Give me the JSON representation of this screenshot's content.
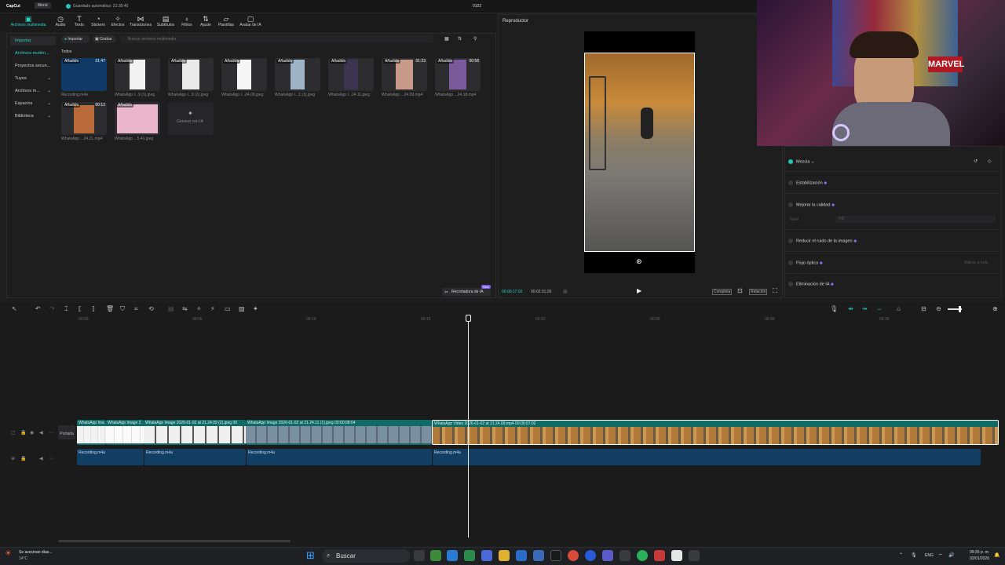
{
  "titlebar": {
    "app": "CapCut",
    "menu": "Menú",
    "autosave": "Guardado automático: 21:35:40",
    "project": "0102"
  },
  "tabs": [
    {
      "label": "Archivos multimedia",
      "icon": "media-icon"
    },
    {
      "label": "Audio",
      "icon": "audio-icon"
    },
    {
      "label": "Texto",
      "icon": "text-icon"
    },
    {
      "label": "Stickers",
      "icon": "sticker-icon"
    },
    {
      "label": "Efectos",
      "icon": "effects-icon"
    },
    {
      "label": "Transiciones",
      "icon": "transition-icon"
    },
    {
      "label": "Subtítulos",
      "icon": "subtitle-icon"
    },
    {
      "label": "Filtros",
      "icon": "filter-icon"
    },
    {
      "label": "Ajuste",
      "icon": "adjust-icon"
    },
    {
      "label": "Plantillas",
      "icon": "template-icon"
    },
    {
      "label": "Avatar de IA",
      "icon": "avatar-icon"
    }
  ],
  "sidebar": {
    "items": [
      "Importar",
      "Archivos multim...",
      "Proyectos secun...",
      "Tuyos",
      "Archivos m...",
      "Espacios",
      "Biblioteca"
    ]
  },
  "media": {
    "import_btn": "Importar",
    "record_btn": "Grabar",
    "search_placeholder": "Buscar archivos multimedia",
    "filter_label": "Todos",
    "items": [
      {
        "badge": "Añadido",
        "dur": "01:47",
        "caption": "Recording.m4a"
      },
      {
        "badge": "Añadido",
        "dur": "",
        "caption": "WhatsApp I...9 (1).jpeg"
      },
      {
        "badge": "Añadido",
        "dur": "",
        "caption": "WhatsApp I...9 (2).jpeg"
      },
      {
        "badge": "Añadido",
        "dur": "",
        "caption": "WhatsApp I...24.09.jpeg"
      },
      {
        "badge": "Añadido",
        "dur": "",
        "caption": "WhatsApp I...1 (1).jpeg"
      },
      {
        "badge": "Añadido",
        "dur": "",
        "caption": "WhatsApp I...24.11.jpeg"
      },
      {
        "badge": "Añadido",
        "dur": "01:23",
        "caption": "WhatsApp ...24.09.mp4"
      },
      {
        "badge": "Añadido",
        "dur": "00:58",
        "caption": "WhatsApp ...24.18.mp4"
      },
      {
        "badge": "Añadido",
        "dur": "00:12",
        "caption": "WhatsApp ...24.21.mp4"
      },
      {
        "badge": "Añadido",
        "dur": "",
        "caption": "WhatsApp ...5.46.jpeg"
      }
    ],
    "generate_label": "Generar con IA",
    "ai_cutter": "Recortadora de IA",
    "new_badge": "New"
  },
  "player": {
    "title": "Reproductor",
    "current_time": "00:00:17:02",
    "total_time": "00:02:31:26",
    "complete_btn": "Completa",
    "ratio_btn": "Relación"
  },
  "adjust": {
    "items": [
      {
        "label": "Mezcla"
      },
      {
        "label": "Estabilización"
      },
      {
        "label": "Mejorar la calidad"
      },
      {
        "label": "Reducir el ruido de la imagen"
      },
      {
        "label": "Flujo óptico"
      },
      {
        "label": "Eliminación de IA"
      }
    ],
    "quality_label": "Nivel",
    "quality_value": "HD",
    "apply_all": "Aplicar a todo"
  },
  "timeline": {
    "ticks": [
      "00:00",
      "00:05",
      "00:10",
      "00:15",
      "00:20",
      "00:25",
      "00:30",
      "00:35"
    ],
    "cover_label": "Portada",
    "video_clips": [
      {
        "label": "WhatsApp Ima"
      },
      {
        "label": "WhatsApp Image 2"
      },
      {
        "label": "WhatsApp Image 2026-01-02 at 21.24.09 (2).jpeg  00"
      },
      {
        "label": "WhatsApp Image 2026-01-02 at 21.24.11 (1).jpeg  00:00:08:04"
      },
      {
        "label": "WhatsApp Video 2026-01-02 at 21.24.09.mp4  00:00:07:02"
      }
    ],
    "audio_clips": [
      {
        "label": "Recording.m4a"
      },
      {
        "label": "Recording.m4a"
      },
      {
        "label": "Recording.m4a"
      },
      {
        "label": "Recording.m4a"
      }
    ]
  },
  "taskbar": {
    "weather_title": "Se avecinan días...",
    "weather_temp": "14°C",
    "search": "Buscar",
    "lang": "ENG",
    "time": "09:35 p. m.",
    "date": "02/01/2026"
  }
}
